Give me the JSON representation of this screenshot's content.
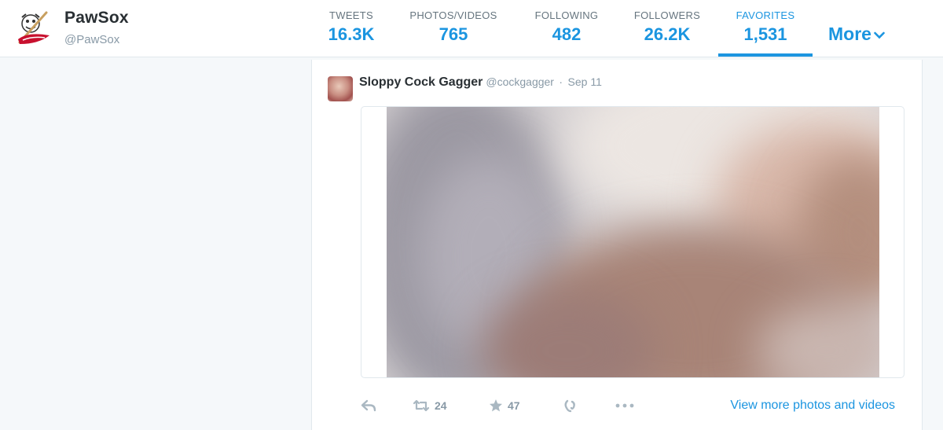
{
  "profile": {
    "name": "PawSox",
    "handle": "@PawSox",
    "avatar_icon": "pawsox-logo"
  },
  "nav": {
    "stats": [
      {
        "label": "TWEETS",
        "value": "16.3K"
      },
      {
        "label": "PHOTOS/VIDEOS",
        "value": "765"
      },
      {
        "label": "FOLLOWING",
        "value": "482"
      },
      {
        "label": "FOLLOWERS",
        "value": "26.2K"
      },
      {
        "label": "FAVORITES",
        "value": "1,531",
        "active": true
      }
    ],
    "more_label": "More"
  },
  "tweet": {
    "author_name": "Sloppy Cock Gagger",
    "author_handle": "@cockgagger",
    "separator": "·",
    "date": "Sep 11",
    "media_state": "blurred",
    "actions": {
      "reply_icon": "reply-icon",
      "retweet_icon": "retweet-icon",
      "retweet_count": "24",
      "favorite_icon": "star-icon",
      "favorite_count": "47",
      "vine_icon": "vine-icon",
      "more_icon": "ellipsis-icon"
    },
    "view_more_label": "View more photos and videos"
  },
  "colors": {
    "accent": "#1b95e0",
    "muted": "#8899a6",
    "icon": "#aab8c2",
    "background": "#f5f8fa",
    "border": "#e1e8ed"
  }
}
